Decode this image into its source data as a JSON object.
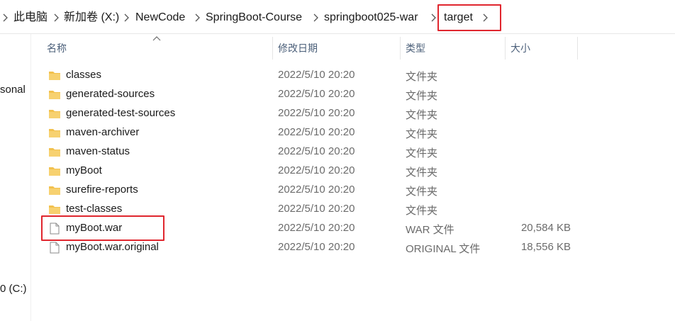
{
  "breadcrumb": {
    "items": [
      "此电脑",
      "新加卷 (X:)",
      "NewCode",
      "SpringBoot-Course",
      "springboot025-war",
      "target"
    ]
  },
  "navpane": {
    "items": [
      "sonal",
      "0 (C:)"
    ]
  },
  "columns": {
    "name": "名称",
    "modified": "修改日期",
    "type": "类型",
    "size": "大小"
  },
  "files": [
    {
      "name": "classes",
      "modified": "2022/5/10 20:20",
      "type": "文件夹",
      "size": "",
      "icon": "folder-icon"
    },
    {
      "name": "generated-sources",
      "modified": "2022/5/10 20:20",
      "type": "文件夹",
      "size": "",
      "icon": "folder-icon"
    },
    {
      "name": "generated-test-sources",
      "modified": "2022/5/10 20:20",
      "type": "文件夹",
      "size": "",
      "icon": "folder-icon"
    },
    {
      "name": "maven-archiver",
      "modified": "2022/5/10 20:20",
      "type": "文件夹",
      "size": "",
      "icon": "folder-icon"
    },
    {
      "name": "maven-status",
      "modified": "2022/5/10 20:20",
      "type": "文件夹",
      "size": "",
      "icon": "folder-icon"
    },
    {
      "name": "myBoot",
      "modified": "2022/5/10 20:20",
      "type": "文件夹",
      "size": "",
      "icon": "folder-icon"
    },
    {
      "name": "surefire-reports",
      "modified": "2022/5/10 20:20",
      "type": "文件夹",
      "size": "",
      "icon": "folder-icon"
    },
    {
      "name": "test-classes",
      "modified": "2022/5/10 20:20",
      "type": "文件夹",
      "size": "",
      "icon": "folder-icon"
    },
    {
      "name": "myBoot.war",
      "modified": "2022/5/10 20:20",
      "type": "WAR 文件",
      "size": "20,584 KB",
      "icon": "file-icon"
    },
    {
      "name": "myBoot.war.original",
      "modified": "2022/5/10 20:20",
      "type": "ORIGINAL 文件",
      "size": "18,556 KB",
      "icon": "file-icon"
    }
  ],
  "colors": {
    "highlight": "#e0262e",
    "folder": "#f2c14e",
    "header_text": "#4c607a"
  }
}
